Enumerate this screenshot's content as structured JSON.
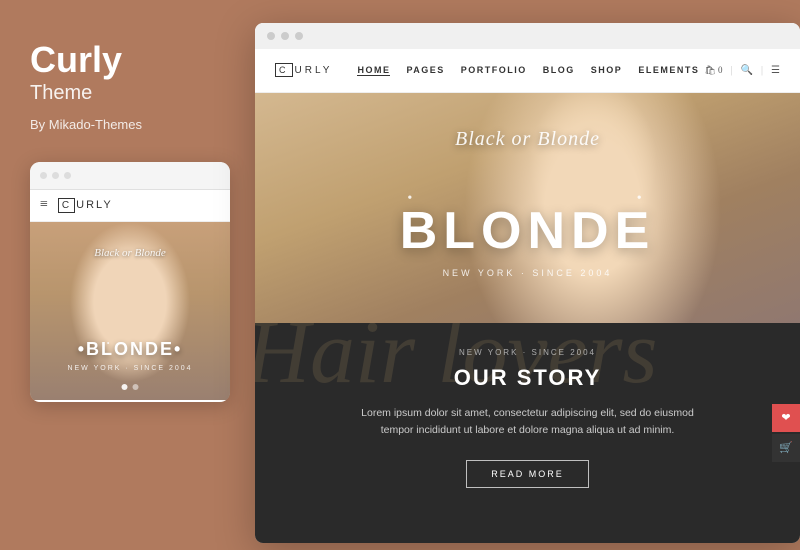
{
  "left": {
    "brand_title": "Curly",
    "brand_subtitle": "Theme",
    "by_line": "By Mikado-Themes",
    "mobile": {
      "dots": [
        "●",
        "●",
        "●"
      ],
      "logo_c": "C",
      "logo_text": "URLY",
      "hero_script": "Black or Blonde",
      "hero_dots": "•",
      "hero_title": "•BLONDE•",
      "hero_subtitle": "NEW YORK · SINCE 2004",
      "page_dots": [
        true,
        false
      ]
    }
  },
  "desktop": {
    "window_dots": [
      "●",
      "●",
      "●"
    ],
    "nav": {
      "logo_c": "C",
      "logo_text": "URLY",
      "links": [
        {
          "label": "HOME",
          "active": true
        },
        {
          "label": "PAGES",
          "active": false
        },
        {
          "label": "PORTFOLIO",
          "active": false
        },
        {
          "label": "BLOG",
          "active": false
        },
        {
          "label": "SHOP",
          "active": false
        },
        {
          "label": "ELEMENTS",
          "active": false
        }
      ],
      "cart_count": "0",
      "icons": [
        "🛍",
        "🔍",
        "☰"
      ]
    },
    "hero": {
      "script_text": "Black or Blonde",
      "dots": "•",
      "main_title": "BLONDE",
      "location": "NEW YORK · SINCE 2004"
    },
    "story": {
      "bg_text": "Hair lovers",
      "location": "NEW YORK · SINCE 2004",
      "title": "OUR STORY",
      "body": "Lorem ipsum dolor sit amet, consectetur adipiscing elit, sed do eiusmod tempor incididunt ut labore et dolore magna aliqua ut ad minim.",
      "button_label": "READ MORE"
    }
  }
}
